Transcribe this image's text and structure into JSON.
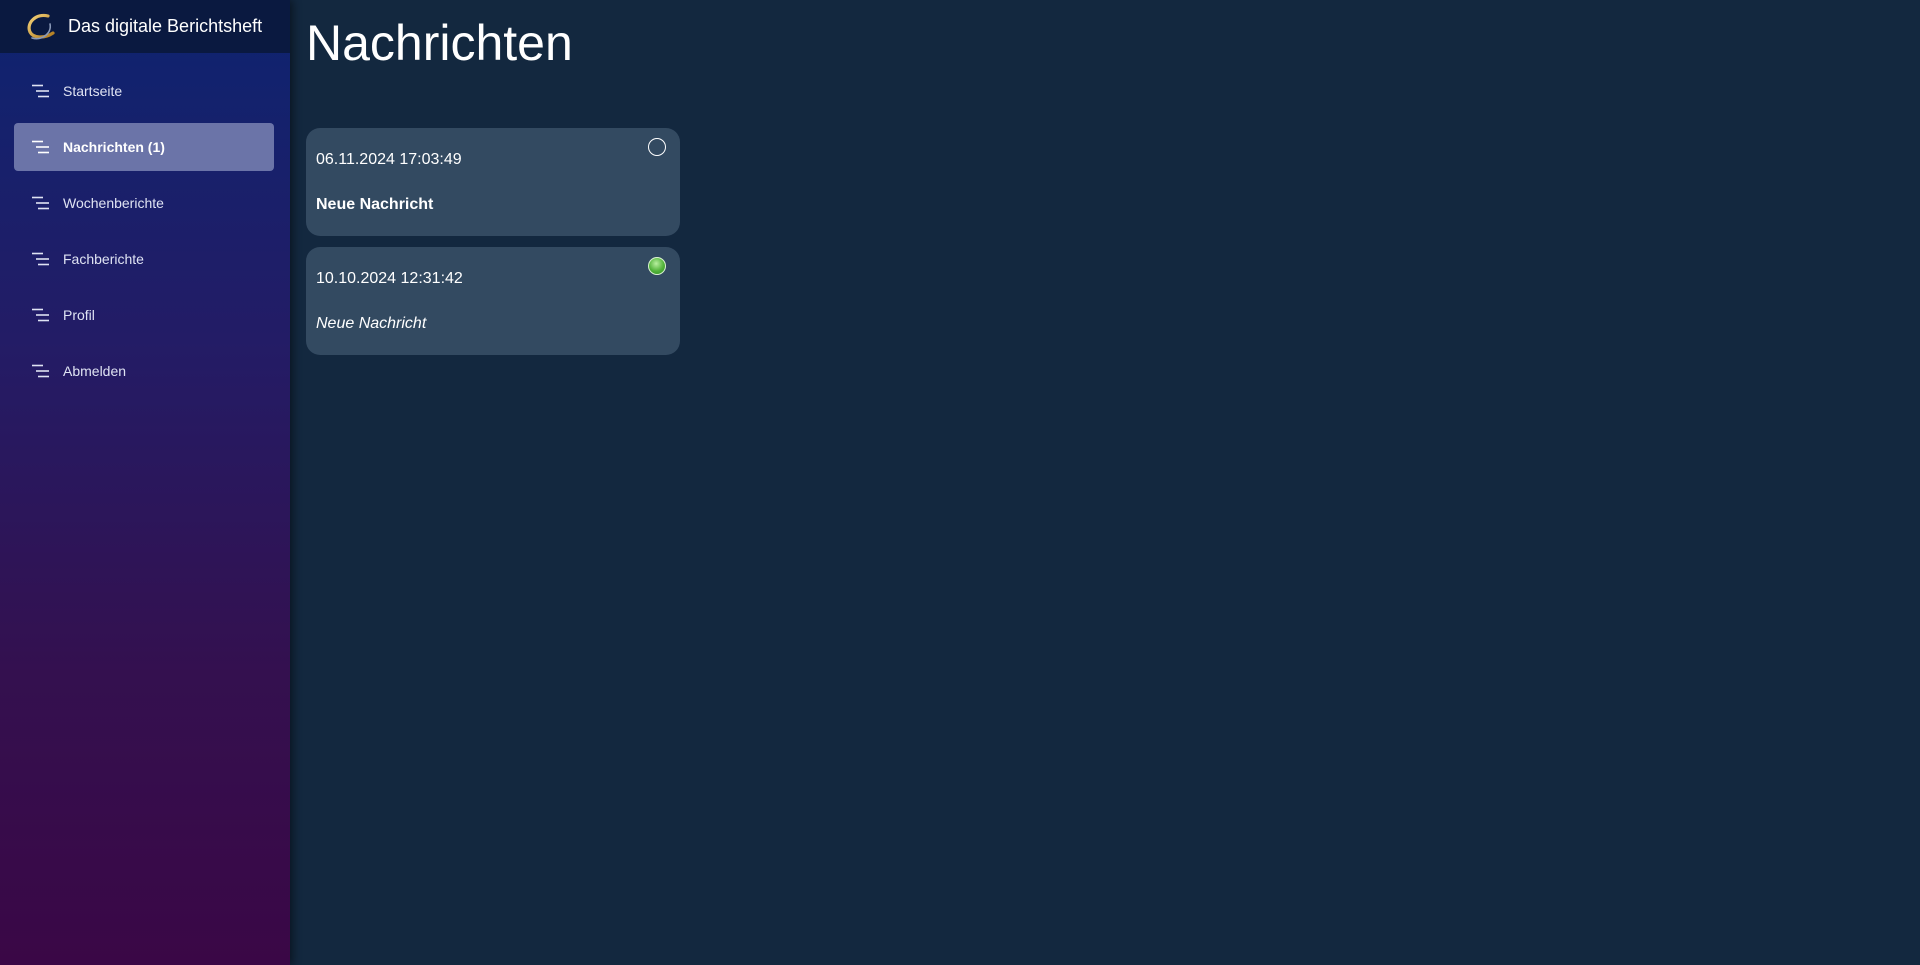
{
  "app": {
    "title": "Das digitale Berichtsheft",
    "colors": {
      "accent": "#6b74a8",
      "background": "#13283f",
      "card": "#334a61",
      "read_status": "#52b33a"
    }
  },
  "sidebar": {
    "items": [
      {
        "label": "Startseite",
        "icon": "menu-lines-icon",
        "active": false
      },
      {
        "label": "Nachrichten (1)",
        "icon": "menu-lines-icon",
        "active": true
      },
      {
        "label": "Wochenberichte",
        "icon": "menu-lines-icon",
        "active": false
      },
      {
        "label": "Fachberichte",
        "icon": "menu-lines-icon",
        "active": false
      },
      {
        "label": "Profil",
        "icon": "menu-lines-icon",
        "active": false
      },
      {
        "label": "Abmelden",
        "icon": "menu-lines-icon",
        "active": false
      }
    ]
  },
  "main": {
    "title": "Nachrichten",
    "messages": [
      {
        "date": "06.11.2024 17:03:49",
        "subject": "Neue Nachricht",
        "status": "unread"
      },
      {
        "date": "10.10.2024 12:31:42",
        "subject": "Neue Nachricht",
        "status": "read"
      }
    ]
  }
}
